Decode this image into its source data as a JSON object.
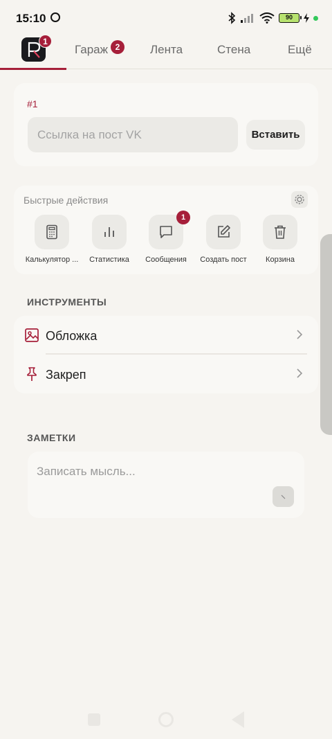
{
  "status": {
    "time": "15:10",
    "battery": "90"
  },
  "nav": {
    "logo_badge": "1",
    "tabs": [
      {
        "label": "Гараж",
        "badge": "2"
      },
      {
        "label": "Лента"
      },
      {
        "label": "Стена"
      },
      {
        "label": "Ещё"
      }
    ]
  },
  "post": {
    "number": "#1",
    "placeholder": "Ссылка на пост VK",
    "paste_label": "Вставить"
  },
  "quick_actions": {
    "title": "Быстрые действия",
    "items": [
      {
        "label": "Калькулятор ...",
        "icon": "calculator-icon"
      },
      {
        "label": "Статистика",
        "icon": "bar-chart-icon"
      },
      {
        "label": "Сообщения",
        "icon": "message-icon",
        "badge": "1"
      },
      {
        "label": "Создать пост",
        "icon": "edit-icon"
      },
      {
        "label": "Корзина",
        "icon": "trash-icon"
      }
    ]
  },
  "tools": {
    "title": "ИНСТРУМЕНТЫ",
    "items": [
      {
        "label": "Обложка",
        "icon": "image-icon"
      },
      {
        "label": "Закреп",
        "icon": "pin-icon"
      }
    ]
  },
  "notes": {
    "title": "ЗАМЕТКИ",
    "placeholder": "Записать мысль..."
  },
  "colors": {
    "accent": "#a61f3a",
    "background": "#f6f4f0"
  }
}
